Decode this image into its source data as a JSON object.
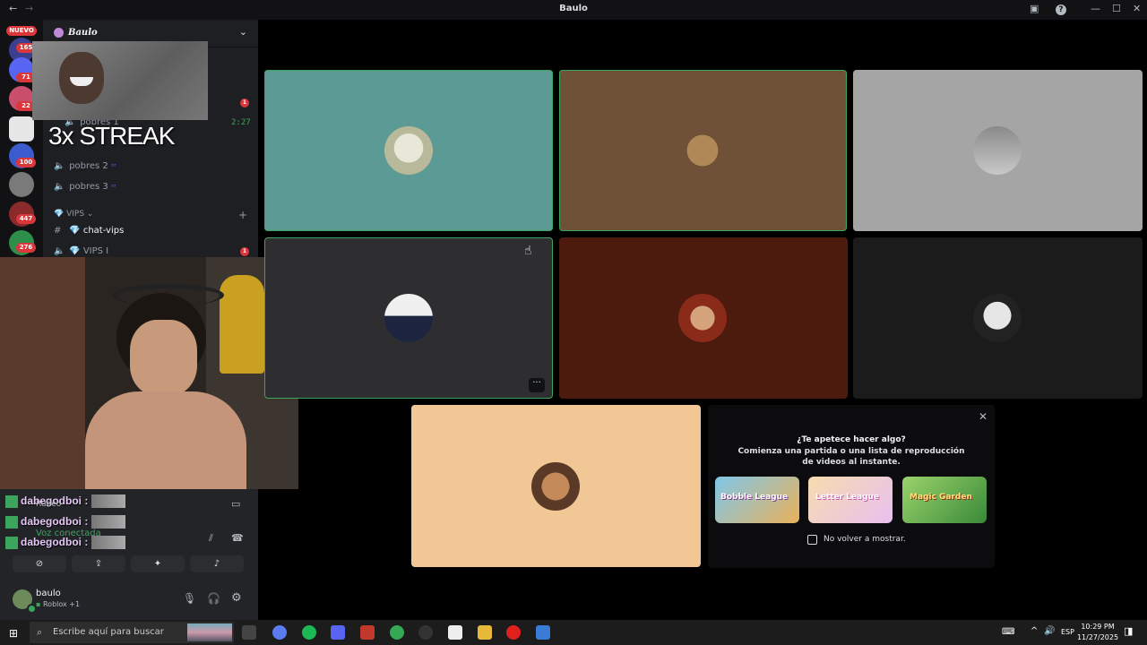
{
  "window": {
    "title": "Baulo",
    "new_badge": "NUEVO"
  },
  "rail": {
    "badges": [
      "165",
      "71",
      "22",
      "100",
      "447",
      "276"
    ]
  },
  "sidebar": {
    "server_name": "Baulo",
    "voice_channels": [
      {
        "label": "pobres 1",
        "time": "2:27"
      },
      {
        "label": "pobres 2"
      },
      {
        "label": "pobres 3"
      }
    ],
    "category": "VIPS",
    "text_channel": "chat-vips",
    "vip_voice": "VIPS I",
    "badge_1": "1",
    "badge_2": "1"
  },
  "overlay": {
    "streak_text": "3x STREAK"
  },
  "chat_overlay": {
    "user": "dabegodboi :",
    "under_1": "Rubéo",
    "under_2": "Voz conectada"
  },
  "user_panel": {
    "username": "baulo",
    "status": "Roblox +1"
  },
  "activity": {
    "heading": "¿Te apetece hacer algo?",
    "subtext": "Comienza una partida o una lista de reproducción de videos al instante.",
    "checkbox_label": "No volver a mostrar.",
    "games": [
      {
        "name": "Bobble League",
        "color": "#e9b15a"
      },
      {
        "name": "Letter League",
        "color": "#f6dcae"
      },
      {
        "name": "Magic Garden",
        "color": "#5aa84a"
      }
    ]
  },
  "taskbar": {
    "search_placeholder": "Escribe aquí para buscar",
    "lang": "ESP",
    "time": "10:29 PM",
    "date": "11/27/2025"
  },
  "colors": {
    "speaking_border": "#3ba55d",
    "tile_teal": "#5c9a96",
    "tile_brown": "#6e5136",
    "tile_gray": "#a5a5a5",
    "tile_dark": "#2e2e31",
    "tile_maroon": "#4d1a0e",
    "tile_black": "#1b1b1b",
    "tile_peach": "#f0c795"
  }
}
